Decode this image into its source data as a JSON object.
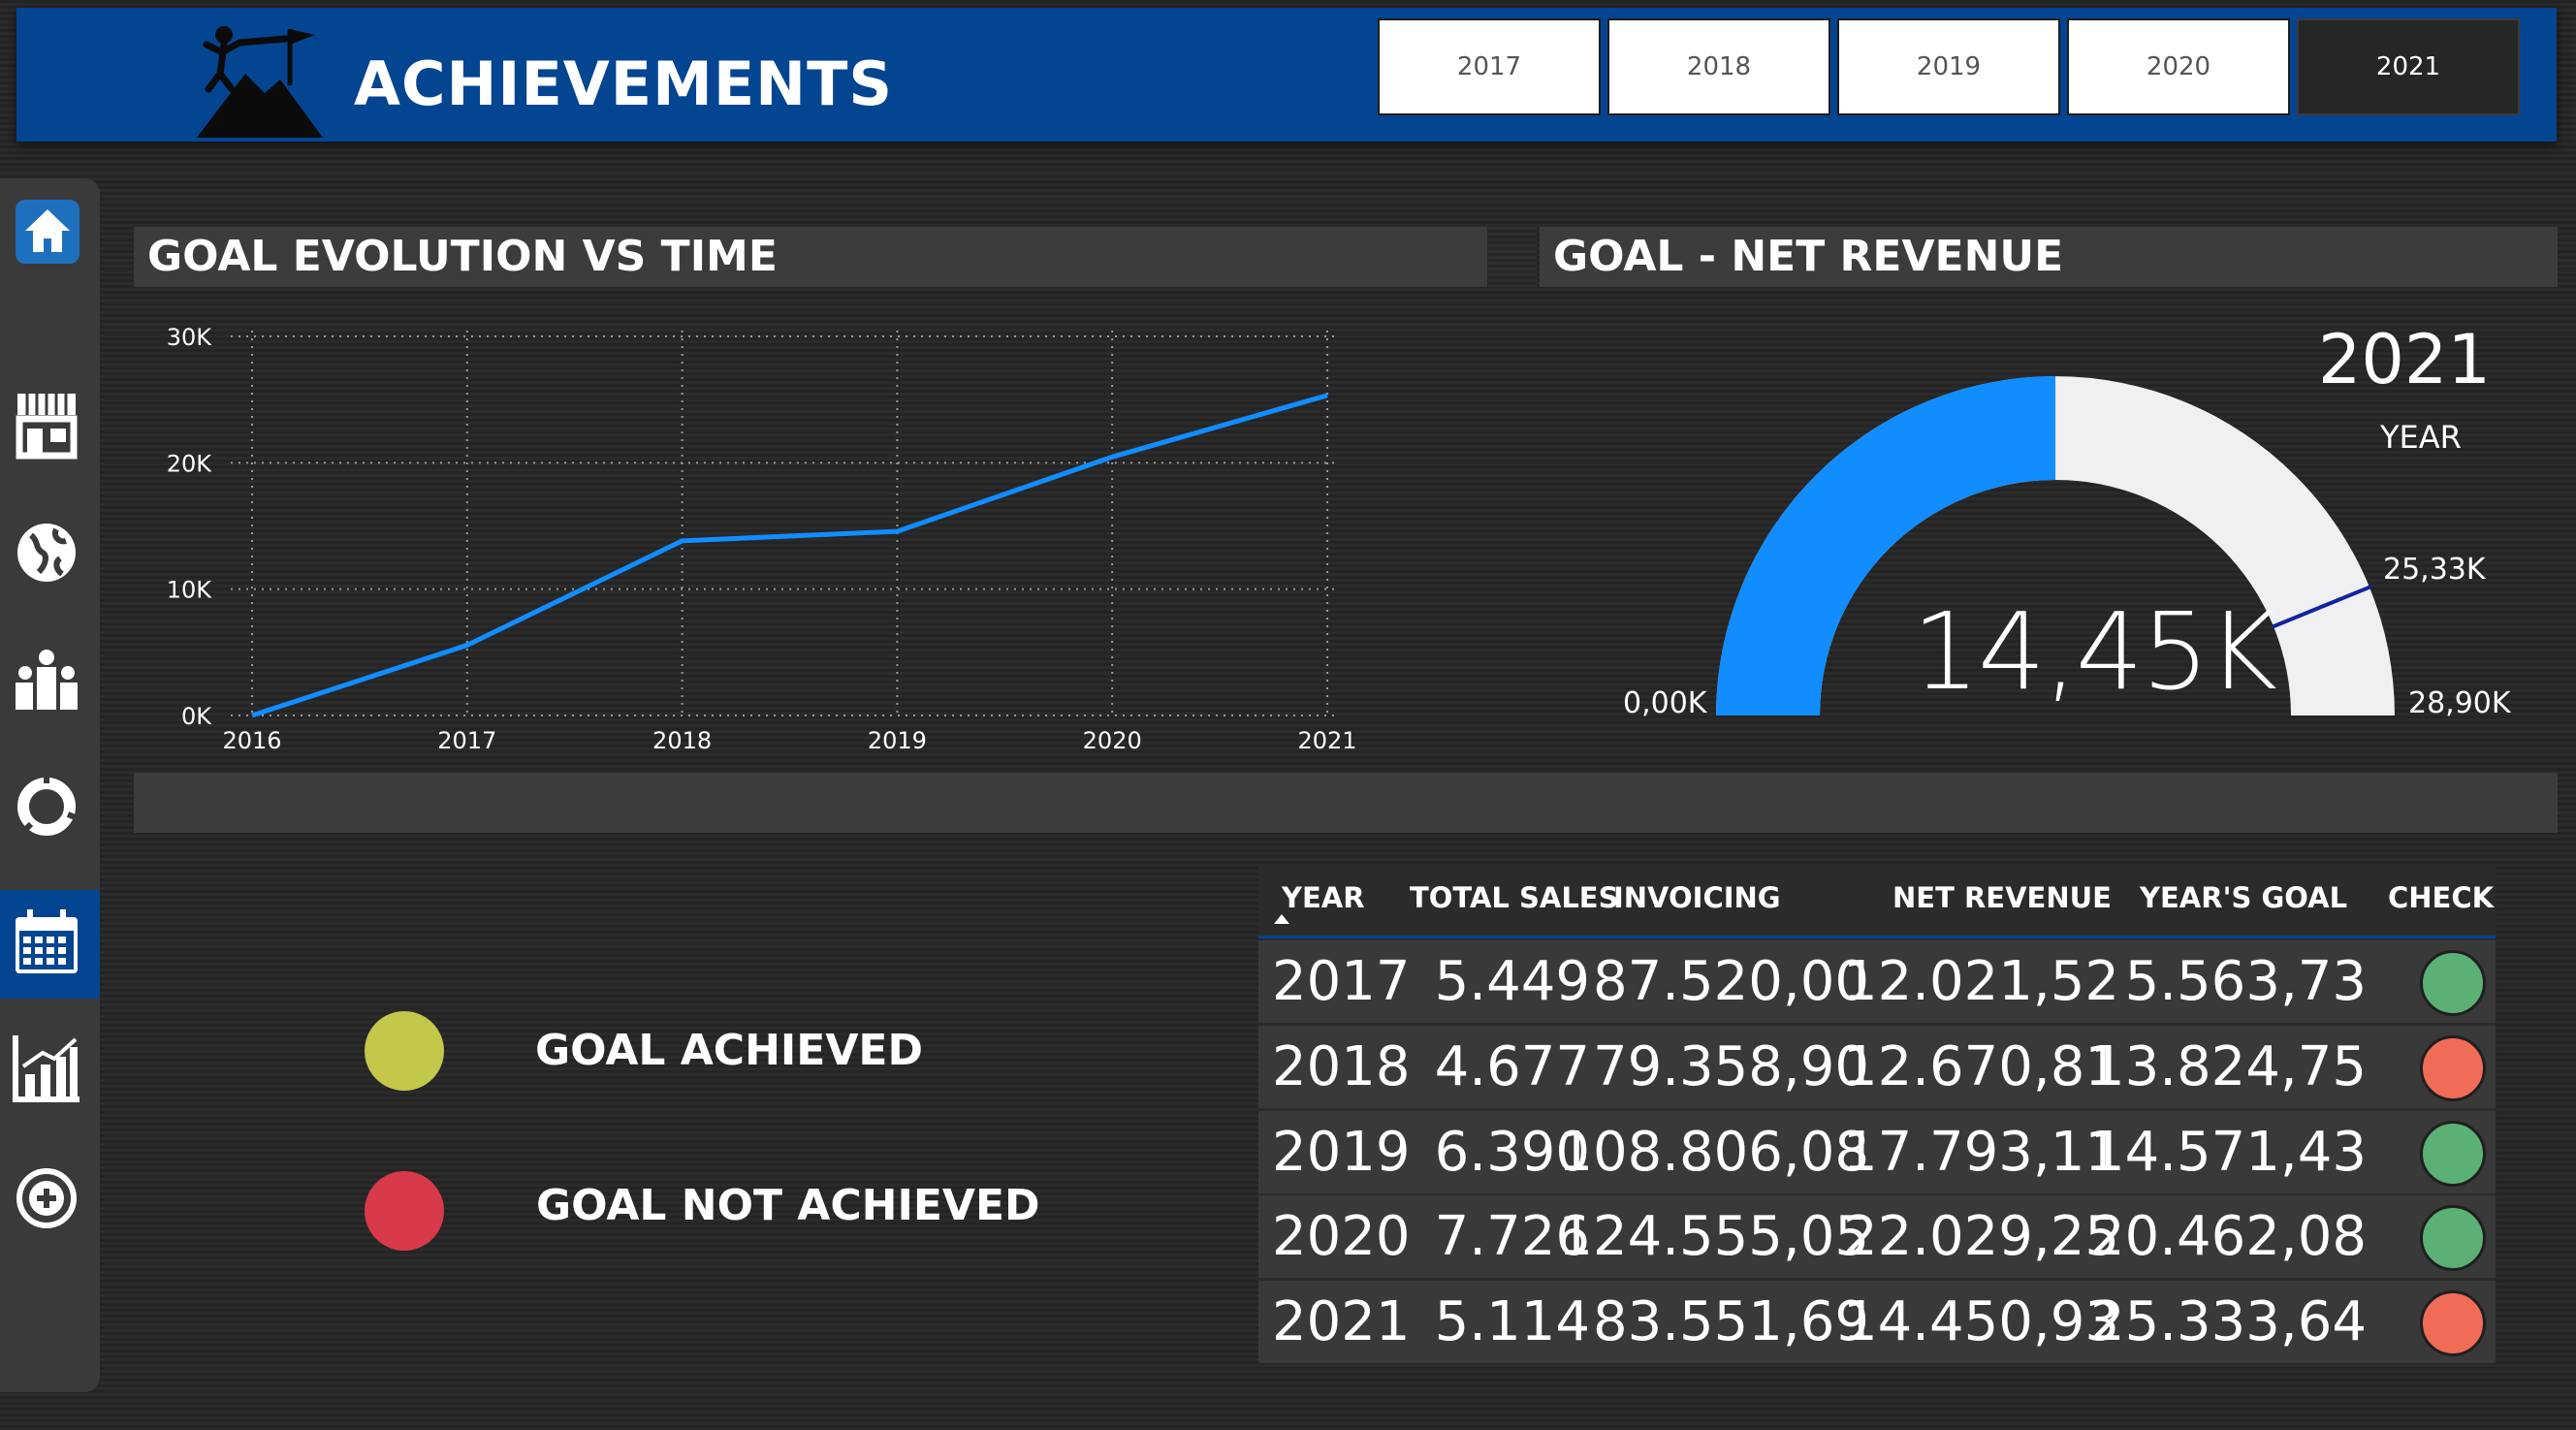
{
  "header": {
    "title": "ACHIEVEMENTS",
    "years": [
      "2017",
      "2018",
      "2019",
      "2020",
      "2021"
    ],
    "selected_year": "2021"
  },
  "sidebar": {
    "items": [
      {
        "name": "home",
        "icon": "home-icon"
      },
      {
        "name": "store",
        "icon": "store-icon"
      },
      {
        "name": "globe",
        "icon": "globe-icon"
      },
      {
        "name": "people",
        "icon": "people-icon"
      },
      {
        "name": "donut",
        "icon": "donut-chart-icon"
      },
      {
        "name": "calendar",
        "icon": "calendar-icon"
      },
      {
        "name": "bar-chart",
        "icon": "bar-chart-icon"
      },
      {
        "name": "add",
        "icon": "add-circle-icon"
      }
    ],
    "active": "calendar"
  },
  "line_panel": {
    "title": "GOAL EVOLUTION VS TIME"
  },
  "gauge_panel": {
    "title": "GOAL - NET REVENUE",
    "year_value": "2021",
    "year_label": "YEAR",
    "value_label": "14,45K",
    "min_label": "0,00K",
    "max_label": "28,90K",
    "target_label": "25,33K",
    "value": 14450.93,
    "min": 0,
    "max": 28900,
    "target": 25333.64,
    "fill_color": "#118dff",
    "track_color": "#f0eff1",
    "target_color": "#12239e"
  },
  "legend": {
    "achieved": "GOAL ACHIEVED",
    "not_achieved": "GOAL NOT ACHIEVED",
    "achieved_color": "#c3c74a",
    "not_achieved_color": "#d83a4a"
  },
  "table": {
    "headers": [
      "YEAR",
      "TOTAL SALES",
      "INVOICING",
      "NET REVENUE",
      "YEAR'S GOAL",
      "CHECK"
    ],
    "rows": [
      {
        "year": "2017",
        "sales": "5.449",
        "invoicing": "87.520,00",
        "net": "12.021,52",
        "goal": "5.563,73",
        "check": "achieved"
      },
      {
        "year": "2018",
        "sales": "4.677",
        "invoicing": "79.358,90",
        "net": "12.670,81",
        "goal": "13.824,75",
        "check": "not_achieved"
      },
      {
        "year": "2019",
        "sales": "6.390",
        "invoicing": "108.806,08",
        "net": "17.793,11",
        "goal": "14.571,43",
        "check": "achieved"
      },
      {
        "year": "2020",
        "sales": "7.726",
        "invoicing": "124.555,05",
        "net": "22.029,25",
        "goal": "20.462,08",
        "check": "achieved"
      },
      {
        "year": "2021",
        "sales": "5.114",
        "invoicing": "83.551,69",
        "net": "14.450,93",
        "goal": "25.333,64",
        "check": "not_achieved"
      }
    ],
    "check_colors": {
      "achieved": "#5bb075",
      "not_achieved": "#f16c56"
    }
  },
  "chart_data": {
    "type": "line",
    "x": [
      2016,
      2017,
      2018,
      2019,
      2020,
      2021
    ],
    "x_tick_labels": [
      "2016",
      "2017",
      "2018",
      "2019",
      "2020",
      "2021"
    ],
    "series": [
      {
        "values": [
          0,
          5563.73,
          13824.75,
          14571.43,
          20462.08,
          25333.64
        ],
        "color": "#118dff"
      }
    ],
    "y_tick_labels": [
      "0K",
      "10K",
      "20K",
      "30K"
    ],
    "y_ticks": [
      0,
      10000,
      20000,
      30000
    ],
    "ylim": [
      0,
      30000
    ],
    "grid": true
  }
}
